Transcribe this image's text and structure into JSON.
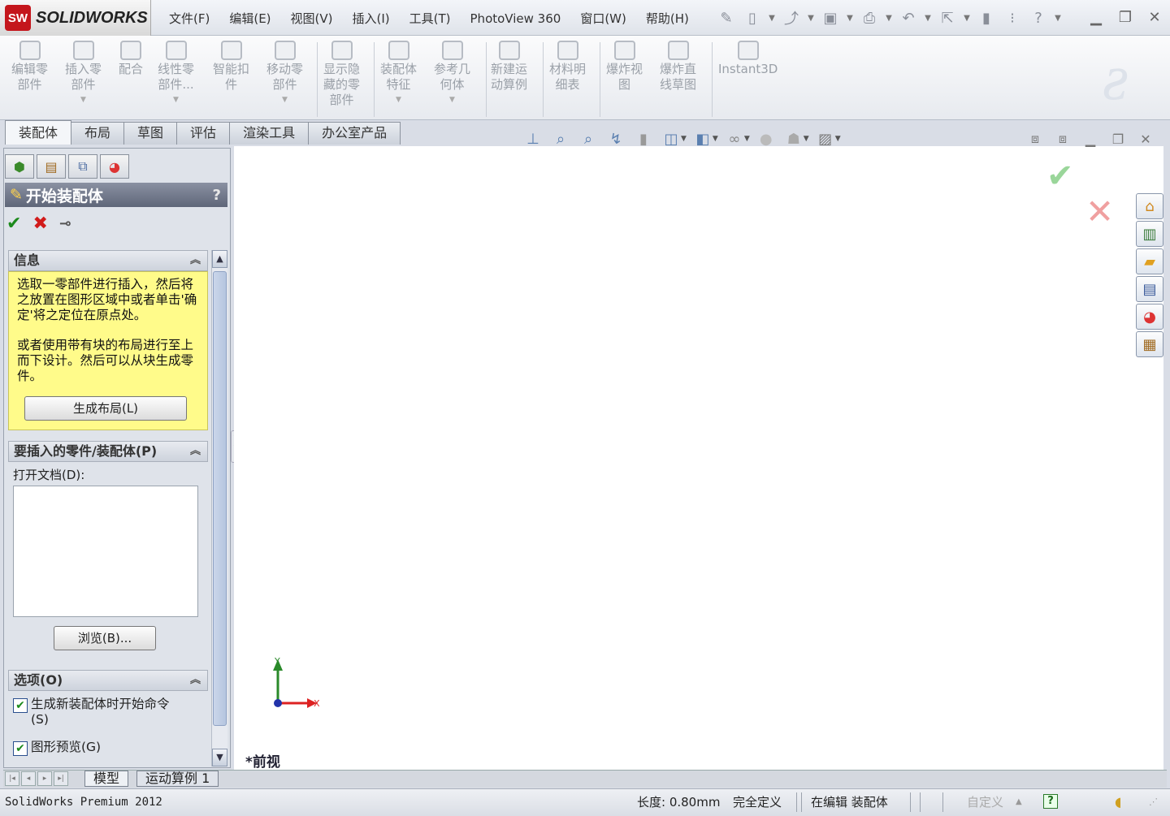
{
  "app": {
    "logo_text": "SW",
    "brand": "SOLIDWORKS"
  },
  "menu": [
    "文件(F)",
    "编辑(E)",
    "视图(V)",
    "插入(I)",
    "工具(T)",
    "PhotoView 360",
    "窗口(W)",
    "帮助(H)"
  ],
  "commands": [
    {
      "label": "编辑零\n部件",
      "dropdown": false
    },
    {
      "label": "插入零\n部件",
      "dropdown": true
    },
    {
      "label": "配合",
      "dropdown": false
    },
    {
      "label": "线性零\n部件...",
      "dropdown": true
    },
    {
      "label": "智能扣\n件",
      "dropdown": false
    },
    {
      "label": "移动零\n部件",
      "dropdown": true
    },
    {
      "label": "显示隐\n藏的零\n部件",
      "dropdown": false
    },
    {
      "label": "装配体\n特征",
      "dropdown": true
    },
    {
      "label": "参考几\n何体",
      "dropdown": true
    },
    {
      "label": "新建运\n动算例",
      "dropdown": false
    },
    {
      "label": "材料明\n细表",
      "dropdown": false
    },
    {
      "label": "爆炸视\n图",
      "dropdown": false
    },
    {
      "label": "爆炸直\n线草图",
      "dropdown": false
    },
    {
      "label": "Instant3D",
      "dropdown": false
    }
  ],
  "tabs": [
    "装配体",
    "布局",
    "草图",
    "评估",
    "渲染工具",
    "办公室产品"
  ],
  "panel": {
    "title": "开始装配体",
    "help": "?",
    "info": {
      "header": "信息",
      "text1": "选取一零部件进行插入，然后将之放置在图形区域中或者单击'确定'将之定位在原点处。",
      "text2": "或者使用带有块的布局进行至上而下设计。然后可以从块生成零件。",
      "button": "生成布局(L)"
    },
    "insert": {
      "header": "要插入的零件/装配体(P)",
      "open_docs_label": "打开文档(D):",
      "browse": "浏览(B)..."
    },
    "options": {
      "header": "选项(O)",
      "items": [
        {
          "label": "生成新装配体时开始命令(S)",
          "checked": true
        },
        {
          "label": "图形预览(G)",
          "checked": true
        }
      ]
    }
  },
  "graphics": {
    "view_name": "*前视",
    "axis_x": "X",
    "axis_y": "Y"
  },
  "bottom_tabs": [
    "模型",
    "运动算例 1"
  ],
  "status": {
    "product": "SolidWorks Premium 2012",
    "length": "长度: 0.80mm",
    "definition": "完全定义",
    "editing": "在编辑 装配体",
    "custom": "自定义",
    "help": "?"
  },
  "colors": {
    "accent": "#c4161c",
    "info_bg": "#fffb8a",
    "ok": "#1c8a1c",
    "cancel": "#d11b1b",
    "axis_x": "#d22",
    "axis_y": "#2a8a2a"
  }
}
